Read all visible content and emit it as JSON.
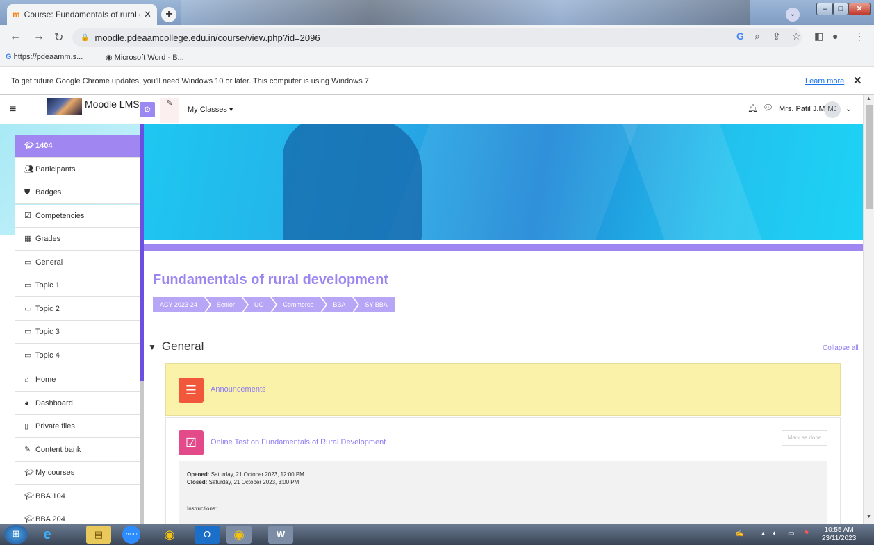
{
  "browser": {
    "tab_title": "Course: Fundamentals of rural de",
    "tab_favicon": "m",
    "url": "moodle.pdeaamcollege.edu.in/course/view.php?id=2096",
    "bookmarks": [
      "https://pdeaamm.s...",
      "Microsoft Word - B..."
    ],
    "infobar_message": "To get future Google Chrome updates, you'll need Windows 10 or later. This computer is using Windows 7.",
    "infobar_link": "Learn more"
  },
  "navbar": {
    "site_name": "Moodle LMS.",
    "my_classes": "My Classes ▾",
    "user_name": "Mrs. Patil J.M.",
    "avatar_initials": "MJ"
  },
  "drawer": {
    "course_items": [
      {
        "label": "1404",
        "icon": "graduation-cap-icon"
      },
      {
        "label": "Participants",
        "icon": "users-icon"
      },
      {
        "label": "Badges",
        "icon": "shield-icon"
      },
      {
        "label": "Competencies",
        "icon": "check-square-icon"
      },
      {
        "label": "Grades",
        "icon": "table-icon"
      },
      {
        "label": "General",
        "icon": "folder-icon"
      },
      {
        "label": "Topic 1",
        "icon": "folder-icon"
      },
      {
        "label": "Topic 2",
        "icon": "folder-icon"
      },
      {
        "label": "Topic 3",
        "icon": "folder-icon"
      },
      {
        "label": "Topic 4",
        "icon": "folder-icon"
      }
    ],
    "site_items": [
      {
        "label": "Home",
        "icon": "home-icon"
      },
      {
        "label": "Dashboard",
        "icon": "dashboard-icon"
      },
      {
        "label": "Private files",
        "icon": "file-icon"
      },
      {
        "label": "Content bank",
        "icon": "brush-icon"
      },
      {
        "label": "My courses",
        "icon": "graduation-cap-icon"
      },
      {
        "label": "BBA 104",
        "icon": "graduation-cap-icon"
      },
      {
        "label": "BBA 204",
        "icon": "graduation-cap-icon"
      }
    ]
  },
  "course": {
    "title": "Fundamentals of rural development",
    "breadcrumbs": [
      "ACY 2023-24",
      "Senior",
      "UG",
      "Commerce",
      "BBA",
      "SY BBA"
    ],
    "section_title": "General",
    "collapse_all": "Collapse all",
    "announcements_label": "Announcements",
    "quiz_label": "Online Test on Fundamentals of Rural Development",
    "mark_as_done": "Mark as done",
    "opened_label": "Opened:",
    "opened_value": "Saturday, 21 October 2023, 12:00 PM",
    "closed_label": "Closed:",
    "closed_value": "Saturday, 21 October 2023, 3:00 PM",
    "instructions": "Instructions:"
  },
  "taskbar": {
    "time": "10:55 AM",
    "date": "23/11/2023",
    "apps": [
      "start-button",
      "internet-explorer",
      "file-explorer",
      "zoom",
      "chrome",
      "outlook",
      "chrome-canary",
      "word"
    ]
  },
  "colors": {
    "accent": "#9f86f0",
    "banner": "#1ec7f0",
    "announcement_bg": "#faf2a8"
  }
}
